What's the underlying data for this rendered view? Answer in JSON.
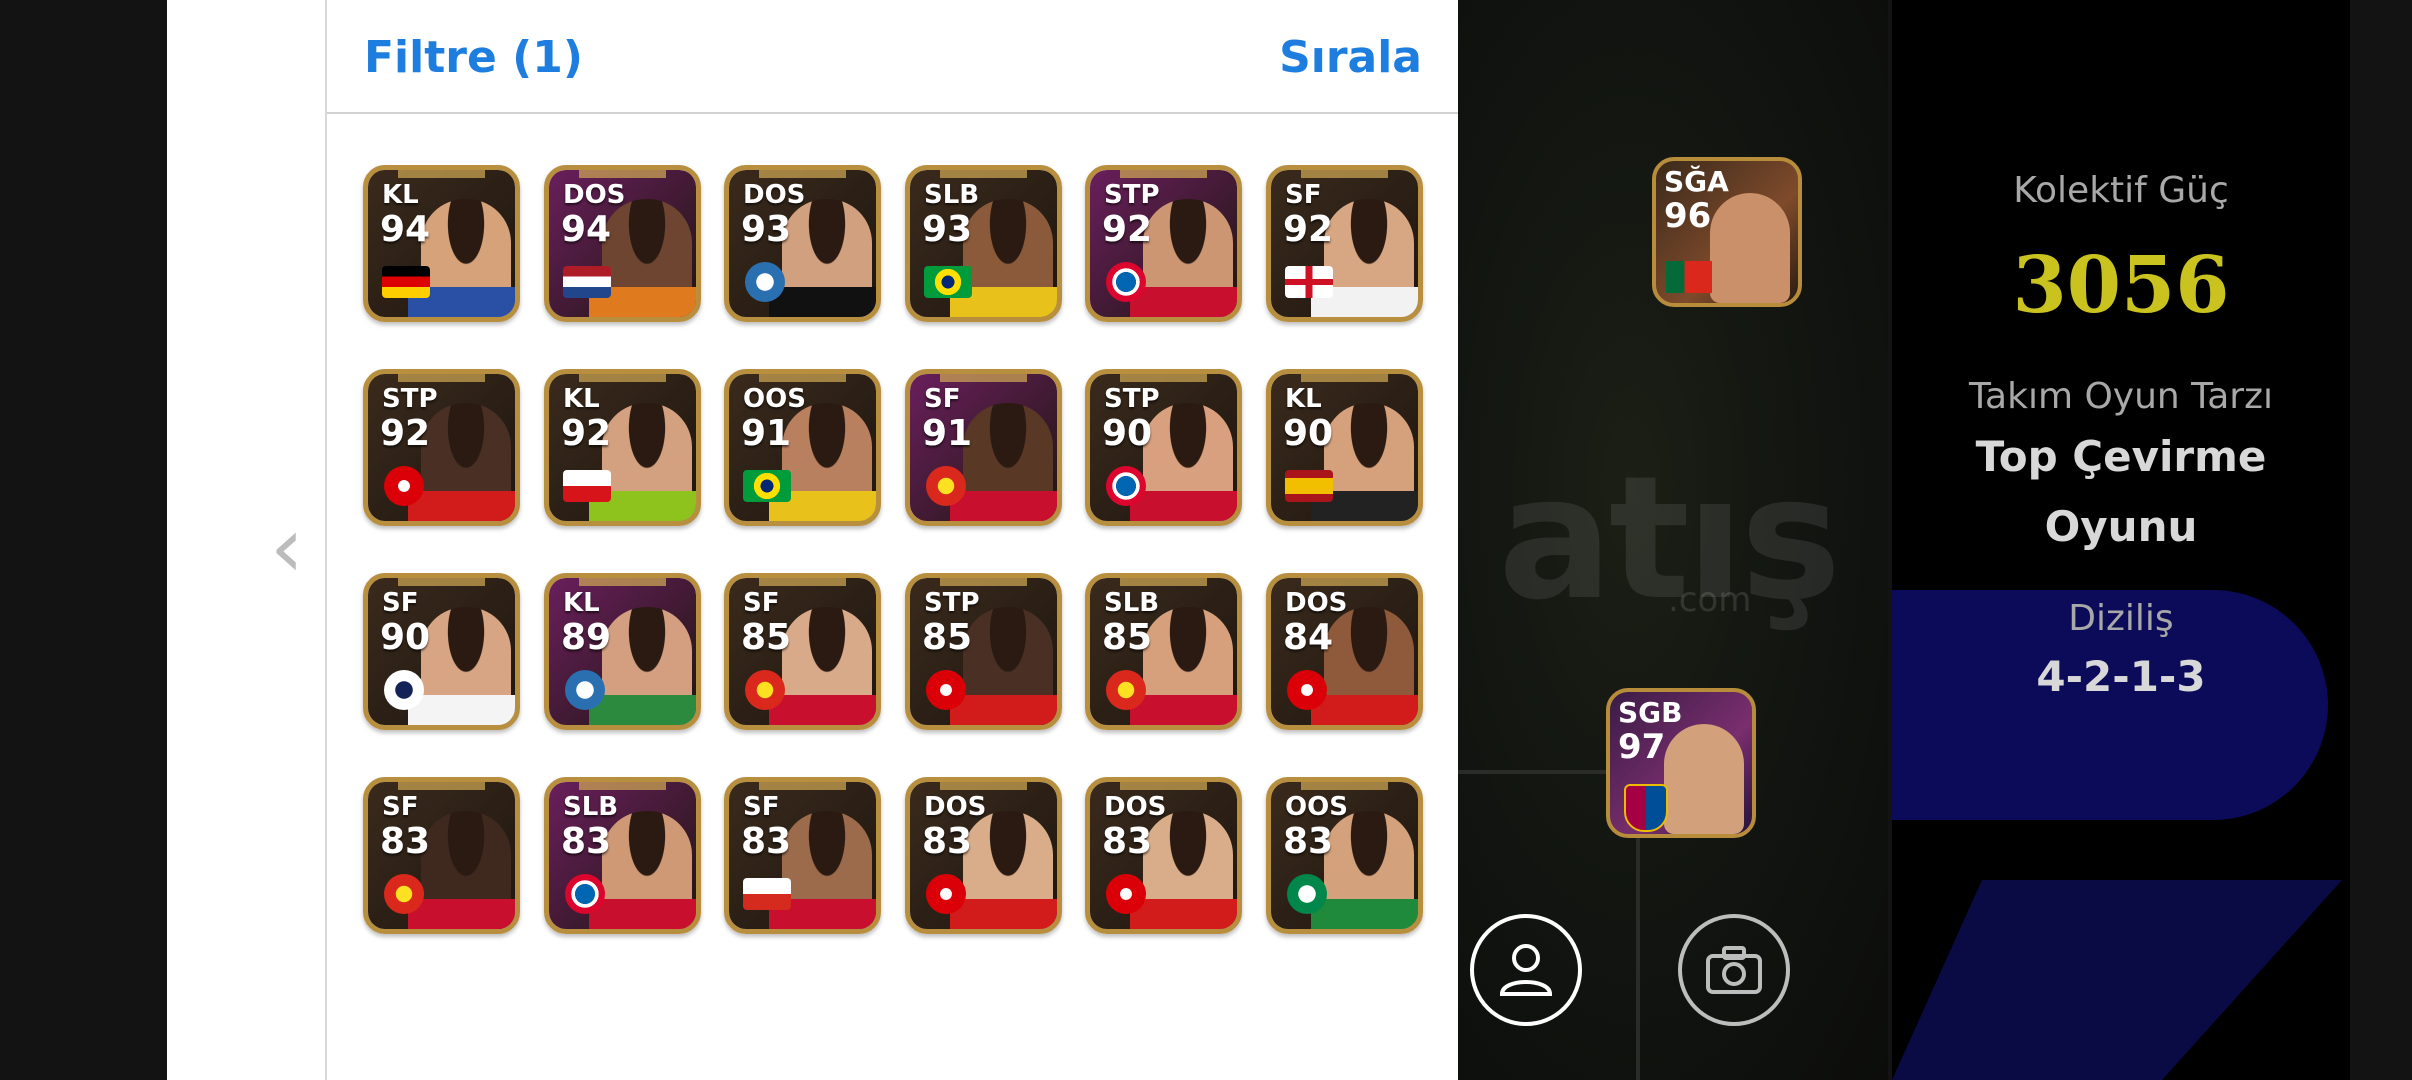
{
  "panel": {
    "filter_label": "Filtre (1)",
    "sort_label": "Sırala"
  },
  "players": [
    {
      "pos": "KL",
      "rating": "94",
      "badge": "flag-germany-icon",
      "bg": "#3a2a1c",
      "face": "#d6a27a",
      "shirt": "#2a50a5"
    },
    {
      "pos": "DOS",
      "rating": "94",
      "badge": "flag-netherlands-icon",
      "bg": "#6a1f5c",
      "face": "#6d4530",
      "shirt": "#e07a1e"
    },
    {
      "pos": "DOS",
      "rating": "93",
      "badge": "club-crest-icon",
      "bg": "#3a2a1c",
      "face": "#d1a07f",
      "shirt": "#111111"
    },
    {
      "pos": "SLB",
      "rating": "93",
      "badge": "flag-brazil-icon",
      "bg": "#3a2a1c",
      "face": "#8a5a3a",
      "shirt": "#e8c21a"
    },
    {
      "pos": "STP",
      "rating": "92",
      "badge": "bayern-crest-icon",
      "bg": "#6a1f5c",
      "face": "#cd9673",
      "shirt": "#c8102e"
    },
    {
      "pos": "SF",
      "rating": "92",
      "badge": "flag-england-icon",
      "bg": "#3a2a1c",
      "face": "#d7a682",
      "shirt": "#f2f2f2"
    },
    {
      "pos": "STP",
      "rating": "92",
      "badge": "arsenal-crest-icon",
      "bg": "#3a2a1c",
      "face": "#4a3024",
      "shirt": "#d21b1b"
    },
    {
      "pos": "KL",
      "rating": "92",
      "badge": "flag-czech-icon",
      "bg": "#3a2a1c",
      "face": "#d3a180",
      "shirt": "#8ec21d"
    },
    {
      "pos": "OOS",
      "rating": "91",
      "badge": "flag-brazil-icon",
      "bg": "#3a2a1c",
      "face": "#b98060",
      "shirt": "#e8c21a"
    },
    {
      "pos": "SF",
      "rating": "91",
      "badge": "manutd-crest-icon",
      "bg": "#6a1f5c",
      "face": "#5a3826",
      "shirt": "#c8102e"
    },
    {
      "pos": "STP",
      "rating": "90",
      "badge": "bayern-crest-icon",
      "bg": "#3a2a1c",
      "face": "#d8a07e",
      "shirt": "#c8102e"
    },
    {
      "pos": "KL",
      "rating": "90",
      "badge": "flag-spain-icon",
      "bg": "#3a2a1c",
      "face": "#d5a07c",
      "shirt": "#222222"
    },
    {
      "pos": "SF",
      "rating": "90",
      "badge": "tottenham-crest-icon",
      "bg": "#3a2a1c",
      "face": "#d8a584",
      "shirt": "#f4f4f4"
    },
    {
      "pos": "KL",
      "rating": "89",
      "badge": "club-crest-icon",
      "bg": "#6a1f5c",
      "face": "#d39f80",
      "shirt": "#2b8a3e"
    },
    {
      "pos": "SF",
      "rating": "85",
      "badge": "manutd-crest-icon",
      "bg": "#3a2a1c",
      "face": "#d9aa8a",
      "shirt": "#c8102e"
    },
    {
      "pos": "STP",
      "rating": "85",
      "badge": "arsenal-crest-icon",
      "bg": "#3a2a1c",
      "face": "#4a3024",
      "shirt": "#d21b1b"
    },
    {
      "pos": "SLB",
      "rating": "85",
      "badge": "manutd-crest-icon",
      "bg": "#3a2a1c",
      "face": "#d6a07d",
      "shirt": "#c8102e"
    },
    {
      "pos": "DOS",
      "rating": "84",
      "badge": "arsenal-crest-icon",
      "bg": "#3a2a1c",
      "face": "#8f5a3c",
      "shirt": "#d21b1b"
    },
    {
      "pos": "SF",
      "rating": "83",
      "badge": "manutd-crest-icon",
      "bg": "#3a2a1c",
      "face": "#3f291f",
      "shirt": "#c8102e"
    },
    {
      "pos": "SLB",
      "rating": "83",
      "badge": "bayern-crest-icon",
      "bg": "#6a1f5c",
      "face": "#cf9976",
      "shirt": "#c8102e"
    },
    {
      "pos": "SF",
      "rating": "83",
      "badge": "flag-chile-icon",
      "bg": "#3a2a1c",
      "face": "#9c6b4c",
      "shirt": "#c8102e"
    },
    {
      "pos": "DOS",
      "rating": "83",
      "badge": "arsenal-crest-icon",
      "bg": "#3a2a1c",
      "face": "#d9ad8a",
      "shirt": "#d21b1b"
    },
    {
      "pos": "DOS",
      "rating": "83",
      "badge": "arsenal-crest-icon",
      "bg": "#3a2a1c",
      "face": "#d9ad8a",
      "shirt": "#d21b1b"
    },
    {
      "pos": "OOS",
      "rating": "83",
      "badge": "celtic-crest-icon",
      "bg": "#3a2a1c",
      "face": "#d3a27c",
      "shirt": "#1f8a3b"
    }
  ],
  "field": {
    "cards": [
      {
        "pos": "SĞA",
        "rating": "96",
        "badge": "flag-portugal-icon"
      },
      {
        "pos": "SGB",
        "rating": "97",
        "badge": "barcelona-crest-icon"
      }
    ]
  },
  "stats": {
    "collective_label": "Kolektif Güç",
    "collective_value": "3056",
    "style_label": "Takım Oyun Tarzı",
    "style_value_line1": "Top Çevirme",
    "style_value_line2": "Oyunu",
    "formation_label": "Diziliş",
    "formation_value": "4-2-1-3"
  },
  "colors": {
    "accent_blue": "#1e7ee0",
    "gold_border": "#b88f3e",
    "power_yellow": "#c9c21f"
  }
}
